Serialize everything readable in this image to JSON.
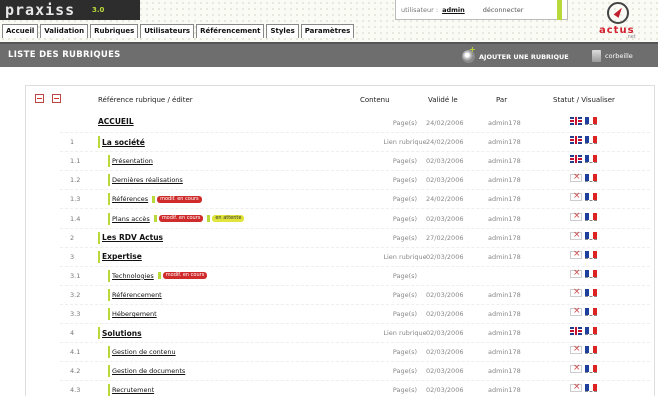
{
  "app": {
    "name": "praxiss",
    "version": "3.0"
  },
  "nav": {
    "tabs": [
      "Accueil",
      "Validation",
      "Rubriques",
      "Utilisateurs",
      "Référencement",
      "Styles",
      "Paramètres"
    ]
  },
  "user": {
    "label": "utilisateur :",
    "name": "admin",
    "logout": "déconnecter"
  },
  "brand": {
    "name": "actus",
    "sub": ".net"
  },
  "section": {
    "title": "LISTE DES RUBRIQUES",
    "add_label": "AJOUTER UNE RUBRIQUE",
    "trash_label": "corbeille"
  },
  "table": {
    "headers": {
      "reference": "Référence rubrique / éditer",
      "contenu": "Contenu",
      "valide": "Validé le",
      "par": "Par",
      "statut": "Statut / Visualiser"
    },
    "rows": [
      {
        "num": "",
        "label": "ACCUEIL",
        "level": 0,
        "contenu": "Page(s)",
        "date": "24/02/2006",
        "par": "admin178",
        "flag_uk": "on",
        "badges": []
      },
      {
        "num": "1",
        "label": "La société",
        "level": 1,
        "contenu": "Lien rubrique",
        "date": "24/02/2006",
        "par": "admin178",
        "flag_uk": "on",
        "badges": []
      },
      {
        "num": "1.1",
        "label": "Présentation",
        "level": 2,
        "contenu": "Page(s)",
        "date": "02/03/2006",
        "par": "admin178",
        "flag_uk": "on",
        "badges": []
      },
      {
        "num": "1.2",
        "label": "Dernières réalisations",
        "level": 2,
        "contenu": "Page(s)",
        "date": "02/03/2006",
        "par": "admin178",
        "flag_uk": "off",
        "badges": []
      },
      {
        "num": "1.3",
        "label": "Références",
        "level": 2,
        "contenu": "Page(s)",
        "date": "24/02/2006",
        "par": "admin178",
        "flag_uk": "off",
        "badges": [
          {
            "text": "modif. en cours",
            "color": "red"
          }
        ]
      },
      {
        "num": "1.4",
        "label": "Plans accès",
        "level": 2,
        "contenu": "Page(s)",
        "date": "02/03/2006",
        "par": "admin178",
        "flag_uk": "off",
        "badges": [
          {
            "text": "modif. en cours",
            "color": "red"
          },
          {
            "text": "en attente",
            "color": "yellow"
          }
        ]
      },
      {
        "num": "2",
        "label": "Les RDV Actus",
        "level": 1,
        "contenu": "Page(s)",
        "date": "27/02/2006",
        "par": "admin178",
        "flag_uk": "off",
        "badges": []
      },
      {
        "num": "3",
        "label": "Expertise",
        "level": 1,
        "contenu": "Lien rubrique",
        "date": "02/03/2006",
        "par": "admin178",
        "flag_uk": "off",
        "badges": []
      },
      {
        "num": "3.1",
        "label": "Technologies",
        "level": 2,
        "contenu": "Page(s)",
        "date": "",
        "par": "",
        "flag_uk": "off",
        "badges": [
          {
            "text": "modif. en cours",
            "color": "red"
          }
        ]
      },
      {
        "num": "3.2",
        "label": "Référencement",
        "level": 2,
        "contenu": "Page(s)",
        "date": "02/03/2006",
        "par": "admin178",
        "flag_uk": "off",
        "badges": []
      },
      {
        "num": "3.3",
        "label": "Hébergement",
        "level": 2,
        "contenu": "Page(s)",
        "date": "02/03/2006",
        "par": "admin178",
        "flag_uk": "off",
        "badges": []
      },
      {
        "num": "4",
        "label": "Solutions",
        "level": 1,
        "contenu": "Lien rubrique",
        "date": "02/03/2006",
        "par": "admin178",
        "flag_uk": "on",
        "badges": []
      },
      {
        "num": "4.1",
        "label": "Gestion de contenu",
        "level": 2,
        "contenu": "Page(s)",
        "date": "02/03/2006",
        "par": "admin178",
        "flag_uk": "off",
        "badges": []
      },
      {
        "num": "4.2",
        "label": "Gestion de documents",
        "level": 2,
        "contenu": "Page(s)",
        "date": "02/03/2006",
        "par": "admin178",
        "flag_uk": "off",
        "badges": []
      },
      {
        "num": "4.3",
        "label": "Recrutement",
        "level": 2,
        "contenu": "Page(s)",
        "date": "02/03/2006",
        "par": "admin178",
        "flag_uk": "off",
        "badges": []
      }
    ]
  },
  "colors": {
    "accent": "#b9d83a",
    "section_bar": "#6e6e6e",
    "badge_red": "#cf2b2b",
    "badge_yellow": "#e1e43b"
  },
  "icons": {
    "add": "gear-plus-icon",
    "trash": "trash-icon",
    "flag_uk": "uk-flag-icon",
    "flag_fr": "fr-flag-icon"
  }
}
